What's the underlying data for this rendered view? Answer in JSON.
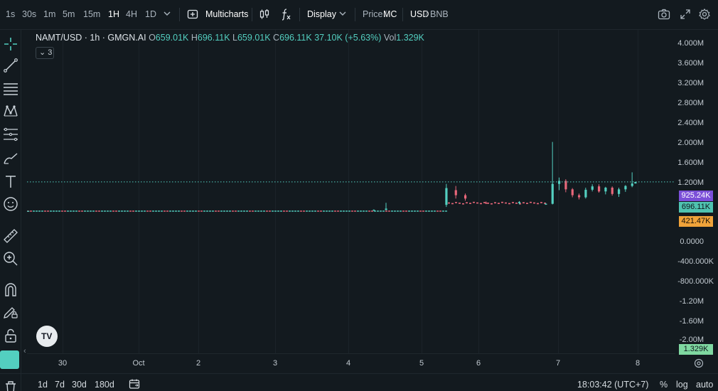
{
  "toolbar": {
    "intervals": [
      "1s",
      "30s",
      "1m",
      "5m",
      "15m",
      "1H",
      "4H",
      "1D"
    ],
    "active_interval": "1H",
    "multicharts_label": "Multicharts",
    "display_label": "Display",
    "price_label": "Price",
    "slash": "/",
    "mc_label": "MC",
    "usd_label": "USD",
    "bnb_label": "BNB"
  },
  "legend": {
    "symbol": "NAMT/USD · 1h · GMGN.AI",
    "o_key": "O",
    "o_val": "659.01K",
    "h_key": "H",
    "h_val": "696.11K",
    "l_key": "L",
    "l_val": "659.01K",
    "c_key": "C",
    "c_val": "696.11K",
    "change": "37.10K (+5.63%)",
    "vol_key": "Vol",
    "vol_val": "1.329K",
    "indicator_count": "3"
  },
  "price_scale": {
    "ticks": [
      "4.000M",
      "3.600M",
      "3.200M",
      "2.800M",
      "2.400M",
      "2.000M",
      "1.600M",
      "1.200M",
      "0.0000",
      "-400.000K",
      "-800.000K",
      "-1.20M",
      "-1.60M",
      "-2.00M"
    ],
    "label_high": "925.24K",
    "label_last": "696.11K",
    "label_low": "421.47K",
    "label_volume": "1.329K"
  },
  "time_scale": {
    "ticks": [
      "30",
      "Oct",
      "2",
      "3",
      "4",
      "5",
      "6",
      "7",
      "8"
    ]
  },
  "bottom": {
    "ranges": [
      "1d",
      "7d",
      "30d",
      "180d"
    ],
    "clock": "18:03:42 (UTC+7)",
    "percent": "%",
    "log": "log",
    "auto": "auto"
  },
  "logo": "TV",
  "colors": {
    "up": "#53cfc0",
    "down": "#e8677a",
    "high_label": "#7b4fd8",
    "last_label": "#4fc3b1",
    "low_label": "#f0a33a",
    "volume_label": "#7fd8a1"
  },
  "chart_data": {
    "type": "candlestick",
    "x_range": [
      "Sep 29",
      "Oct 8"
    ],
    "y_range": [
      -2000000,
      4000000
    ],
    "last_price": 696110,
    "candles": [
      {
        "t": "Sep 29 12:00",
        "o": 5000,
        "h": 8000,
        "l": 3000,
        "c": 6000
      },
      {
        "t": "Oct 4 08:00",
        "o": 20000,
        "h": 40000,
        "l": 10000,
        "c": 30000
      },
      {
        "t": "Oct 4 12:00",
        "o": 30000,
        "h": 200000,
        "l": 20000,
        "c": 60000
      },
      {
        "t": "Oct 5 10:00",
        "o": 150000,
        "h": 650000,
        "l": 100000,
        "c": 550000
      },
      {
        "t": "Oct 5 14:00",
        "o": 500000,
        "h": 600000,
        "l": 300000,
        "c": 380000
      },
      {
        "t": "Oct 5 18:00",
        "o": 380000,
        "h": 420000,
        "l": 250000,
        "c": 300000
      },
      {
        "t": "Oct 6 02:00",
        "o": 200000,
        "h": 230000,
        "l": 170000,
        "c": 190000
      },
      {
        "t": "Oct 6 12:00",
        "o": 190000,
        "h": 240000,
        "l": 160000,
        "c": 220000
      },
      {
        "t": "Oct 6 20:00",
        "o": 170000,
        "h": 190000,
        "l": 150000,
        "c": 175000
      },
      {
        "t": "Oct 6 22:00",
        "o": 175000,
        "h": 1650000,
        "l": 160000,
        "c": 650000
      },
      {
        "t": "Oct 7 00:00",
        "o": 650000,
        "h": 800000,
        "l": 500000,
        "c": 720000
      },
      {
        "t": "Oct 7 02:00",
        "o": 720000,
        "h": 760000,
        "l": 450000,
        "c": 520000
      },
      {
        "t": "Oct 7 04:00",
        "o": 520000,
        "h": 550000,
        "l": 330000,
        "c": 380000
      },
      {
        "t": "Oct 7 06:00",
        "o": 380000,
        "h": 420000,
        "l": 280000,
        "c": 330000
      },
      {
        "t": "Oct 7 08:00",
        "o": 330000,
        "h": 560000,
        "l": 300000,
        "c": 510000
      },
      {
        "t": "Oct 7 10:00",
        "o": 510000,
        "h": 640000,
        "l": 470000,
        "c": 590000
      },
      {
        "t": "Oct 7 12:00",
        "o": 590000,
        "h": 640000,
        "l": 440000,
        "c": 470000
      },
      {
        "t": "Oct 7 14:00",
        "o": 470000,
        "h": 580000,
        "l": 400000,
        "c": 560000
      },
      {
        "t": "Oct 7 16:00",
        "o": 560000,
        "h": 590000,
        "l": 370000,
        "c": 410000
      },
      {
        "t": "Oct 7 18:00",
        "o": 410000,
        "h": 560000,
        "l": 340000,
        "c": 520000
      },
      {
        "t": "Oct 7 20:00",
        "o": 520000,
        "h": 620000,
        "l": 460000,
        "c": 600000
      },
      {
        "t": "Oct 7 22:00",
        "o": 600000,
        "h": 925240,
        "l": 570000,
        "c": 659010
      },
      {
        "t": "Oct 7 23:00",
        "o": 659010,
        "h": 696110,
        "l": 659010,
        "c": 696110
      }
    ]
  }
}
